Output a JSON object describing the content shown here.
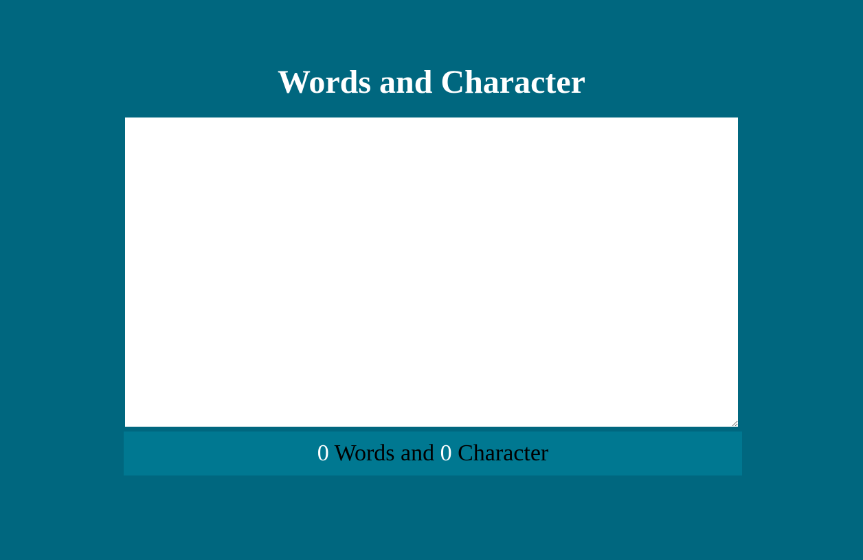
{
  "page": {
    "title": "Words and Character"
  },
  "editor": {
    "value": "",
    "placeholder": ""
  },
  "stats": {
    "word_count": "0",
    "words_label": " Words and ",
    "char_count": "0",
    "chars_label": " Character"
  },
  "colors": {
    "background": "#00677f",
    "stats_bar": "#007891",
    "count_text": "#ffffff",
    "label_text": "#000000",
    "title_text": "#ffffff"
  }
}
